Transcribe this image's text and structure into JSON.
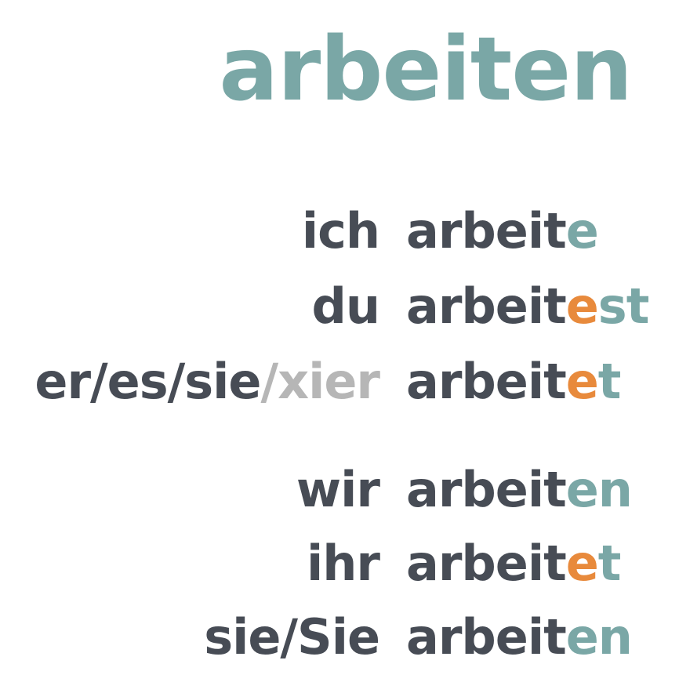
{
  "title": "arbeiten",
  "colors": {
    "text": "#474c55",
    "teal": "#7aa7a6",
    "orange": "#e88a3c",
    "gray": "#b6b6b6"
  },
  "rows": [
    {
      "pronoun": "ich",
      "pronoun_extra": "",
      "stem": "arbeit",
      "connector": "",
      "ending": "e"
    },
    {
      "pronoun": "du",
      "pronoun_extra": "",
      "stem": "arbeit",
      "connector": "e",
      "ending": "st"
    },
    {
      "pronoun": "er/es/sie",
      "pronoun_extra": "/xier",
      "stem": "arbeit",
      "connector": "e",
      "ending": "t"
    },
    {
      "pronoun": "wir",
      "pronoun_extra": "",
      "stem": "arbeit",
      "connector": "",
      "ending": "en"
    },
    {
      "pronoun": "ihr",
      "pronoun_extra": "",
      "stem": "arbeit",
      "connector": "e",
      "ending": "t"
    },
    {
      "pronoun": "sie/Sie",
      "pronoun_extra": "",
      "stem": "arbeit",
      "connector": "",
      "ending": "en"
    }
  ]
}
